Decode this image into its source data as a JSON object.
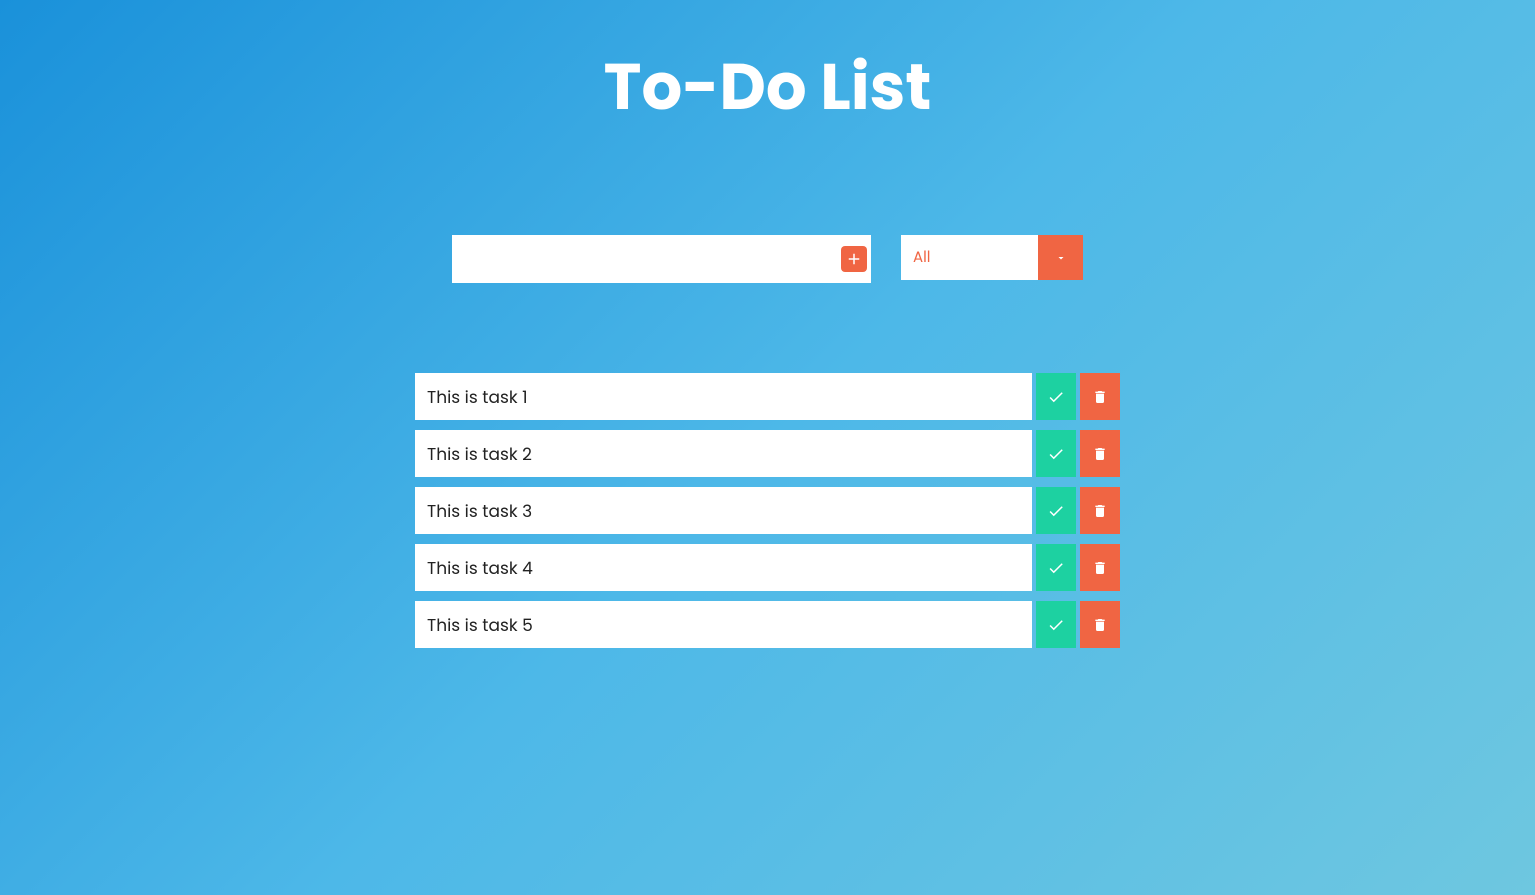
{
  "title": "To-Do List",
  "input": {
    "value": "",
    "placeholder": ""
  },
  "filter": {
    "selected": "All"
  },
  "tasks": [
    {
      "text": "This is task 1"
    },
    {
      "text": "This is task 2"
    },
    {
      "text": "This is task 3"
    },
    {
      "text": "This is task 4"
    },
    {
      "text": "This is task 5"
    }
  ]
}
